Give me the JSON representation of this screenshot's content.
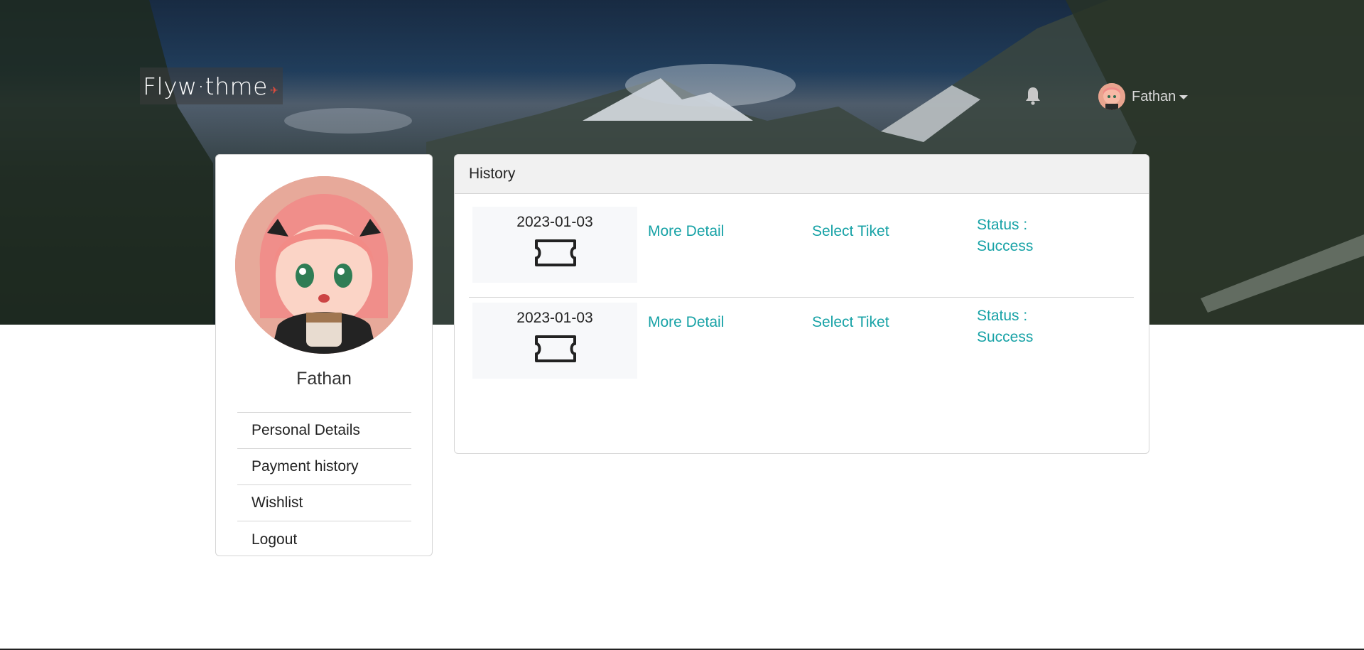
{
  "brand": {
    "logo_text": "Flyw·thme"
  },
  "nav": {
    "user_name": "Fathan",
    "icons": [
      "bell-icon",
      "caret-down-icon"
    ]
  },
  "profile": {
    "name": "Fathan",
    "menu": [
      "Personal Details",
      "Payment history",
      "Wishlist",
      "Logout"
    ]
  },
  "history": {
    "title": "History",
    "rows": [
      {
        "date": "2023-01-03",
        "more_label": "More Detail",
        "select_label": "Select Tiket",
        "status_label": "Status :",
        "status_value": "Success"
      },
      {
        "date": "2023-01-03",
        "more_label": "More Detail",
        "select_label": "Select Tiket",
        "status_label": "Status :",
        "status_value": "Success"
      }
    ]
  },
  "colors": {
    "accent": "#17a2a6",
    "hero_overlay": "#1d2a38",
    "card_border": "#d5d5d5"
  }
}
